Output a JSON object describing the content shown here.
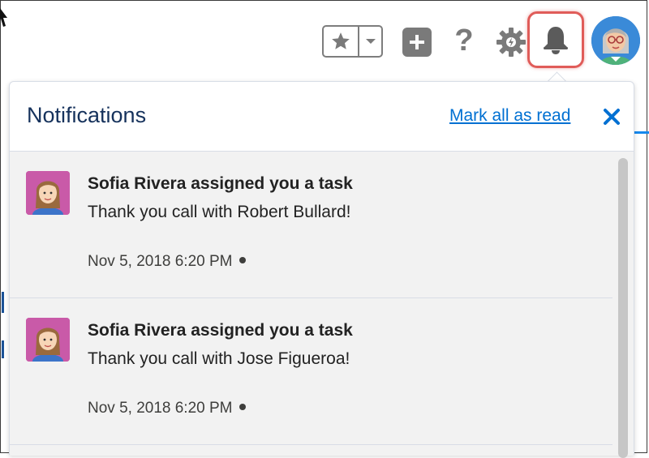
{
  "header": {
    "icons": {
      "favorites": "star-icon",
      "favorites_menu": "chevron-down-icon",
      "global_actions": "plus-icon",
      "help": "question-mark-icon",
      "help_glyph": "?",
      "setup": "gear-icon",
      "notifications": "bell-icon",
      "profile": "avatar"
    },
    "colors": {
      "icon_gray": "#7a7a7a",
      "bell_highlight": "#e05c59",
      "avatar_bg": "#2d7fc9"
    }
  },
  "notifications_panel": {
    "title": "Notifications",
    "mark_all_read_label": "Mark all as read",
    "close_icon": "close-icon",
    "link_color": "#0070d2",
    "items": [
      {
        "title": "Sofia Rivera assigned you a task",
        "body": "Thank you call with Robert Bullard!",
        "timestamp": "Nov 5, 2018 6:20 PM",
        "unread": true,
        "avatar": "user-avatar"
      },
      {
        "title": "Sofia Rivera assigned you a task",
        "body": "Thank you call with Jose Figueroa!",
        "timestamp": "Nov 5, 2018 6:20 PM",
        "unread": true,
        "avatar": "user-avatar"
      }
    ]
  }
}
